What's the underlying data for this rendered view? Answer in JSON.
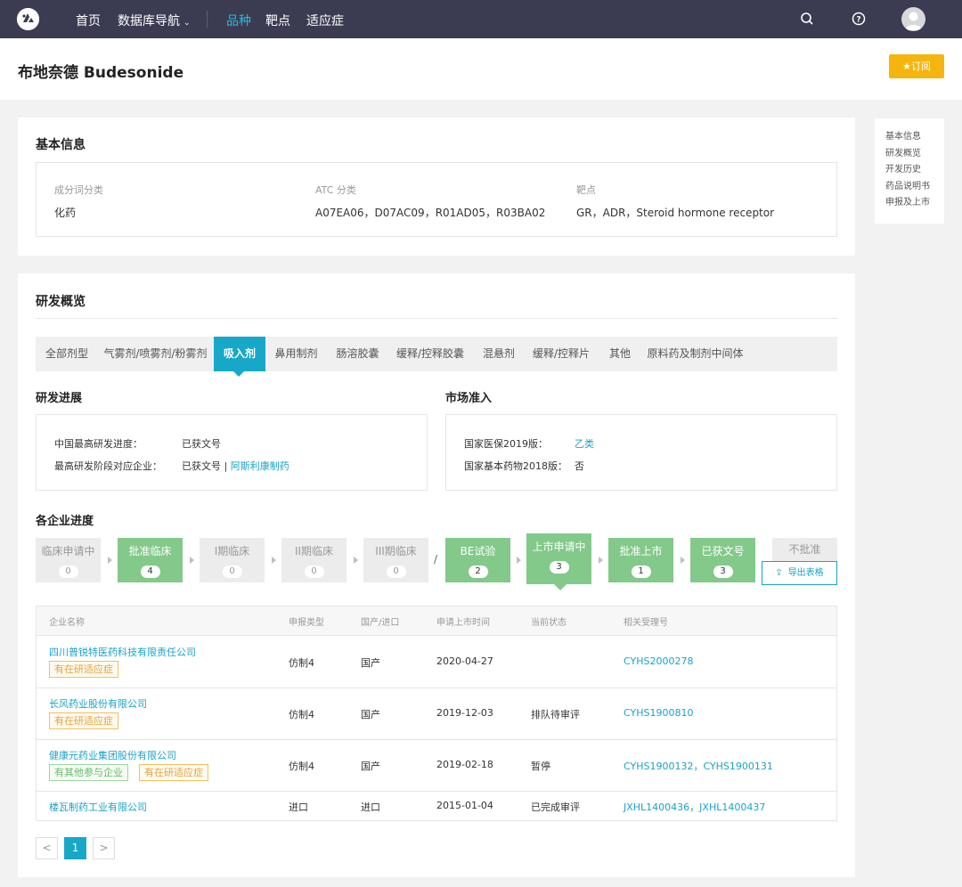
{
  "nav": {
    "items": [
      {
        "label": "首页"
      },
      {
        "label": "数据库导航"
      },
      {
        "label": "品种"
      },
      {
        "label": "靶点"
      },
      {
        "label": "适应症"
      }
    ]
  },
  "header": {
    "title": "布地奈德 Budesonide",
    "subscribe_label": "订阅"
  },
  "right_nav": [
    "基本信息",
    "研发概览",
    "开发历史",
    "药品说明书",
    "申报及上市"
  ],
  "basic_info": {
    "title": "基本信息",
    "fields": [
      {
        "label": "成分词分类",
        "value": "化药"
      },
      {
        "label": "ATC 分类",
        "value": "A07EA06，D07AC09，R01AD05，R03BA02"
      },
      {
        "label": "靶点",
        "value": "GR，ADR，Steroid hormone receptor"
      }
    ]
  },
  "overview": {
    "title": "研发概览",
    "tabs": [
      "全部剂型",
      "气雾剂/喷雾剂/粉雾剂",
      "吸入剂",
      "鼻用制剂",
      "肠溶胶囊",
      "缓释/控释胶囊",
      "混悬剂",
      "缓释/控释片",
      "其他",
      "原料药及制剂中间体"
    ],
    "active_tab": "吸入剂",
    "progress": {
      "title": "研发进展",
      "rows": [
        {
          "label": "中国最高研发进度：",
          "value": "已获文号",
          "link": ""
        },
        {
          "label": "最高研发阶段对应企业：",
          "value": "已获文号 | ",
          "link": "阿斯利康制药"
        }
      ]
    },
    "market": {
      "title": "市场准入",
      "rows": [
        {
          "label": "国家医保2019版：",
          "value": "乙类"
        },
        {
          "label": "国家基本药物2018版：",
          "value": "否"
        }
      ]
    },
    "company_progress": {
      "title": "各企业进度",
      "steps": [
        {
          "label": "临床申请中",
          "count": "0"
        },
        {
          "label": "批准临床",
          "count": "4"
        },
        {
          "label": "I期临床",
          "count": "0"
        },
        {
          "label": "II期临床",
          "count": "0"
        },
        {
          "label": "III期临床",
          "count": "0"
        },
        {
          "label": "BE试验",
          "count": "2"
        },
        {
          "label": "上市申请中",
          "count": "3"
        },
        {
          "label": "批准上市",
          "count": "1"
        },
        {
          "label": "已获文号",
          "count": "3"
        }
      ],
      "separator": "/",
      "rejected_label": "不批准",
      "export_label": "导出表格"
    },
    "table": {
      "headers": [
        "企业名称",
        "申报类型",
        "国产/进口",
        "申请上市时间",
        "当前状态",
        "相关受理号"
      ],
      "rows": [
        {
          "company": "四川普锐特医药科技有限责任公司",
          "tags": [
            {
              "text": "有在研适应症",
              "color": "orange"
            }
          ],
          "type": "仿制4",
          "origin": "国产",
          "date": "2020-04-27",
          "status": "",
          "numbers": "CYHS2000278"
        },
        {
          "company": "长风药业股份有限公司",
          "tags": [
            {
              "text": "有在研适应症",
              "color": "orange"
            }
          ],
          "type": "仿制4",
          "origin": "国产",
          "date": "2019-12-03",
          "status": "排队待审评",
          "numbers": "CYHS1900810"
        },
        {
          "company": "健康元药业集团股份有限公司",
          "tags": [
            {
              "text": "有其他参与企业",
              "color": "green"
            },
            {
              "text": "有在研适应症",
              "color": "orange"
            }
          ],
          "type": "仿制4",
          "origin": "国产",
          "date": "2019-02-18",
          "status": "暂停",
          "numbers": "CYHS1900132，CYHS1900131"
        },
        {
          "company": "楼瓦制药工业有限公司",
          "tags": [],
          "type": "进口",
          "origin": "进口",
          "date": "2015-01-04",
          "status": "已完成审评",
          "numbers": "JXHL1400436，JXHL1400437"
        }
      ]
    },
    "pagination": {
      "prev": "<",
      "current": "1",
      "next": ">"
    }
  },
  "colors": {
    "nav_bg": "#3b3c52",
    "accent": "#17a8c9",
    "step_green": "#83c98a",
    "subscribe": "#f5b50e"
  }
}
